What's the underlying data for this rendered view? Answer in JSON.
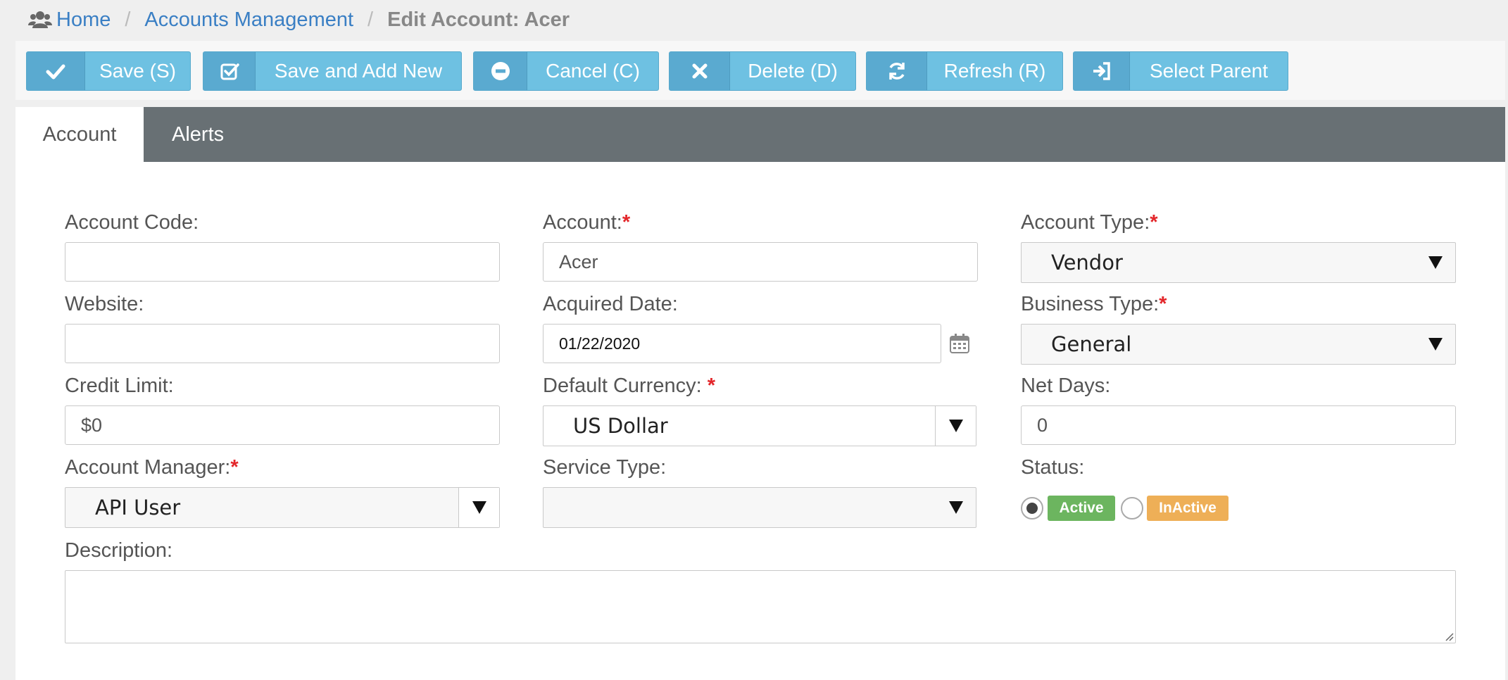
{
  "breadcrumb": {
    "home": "Home",
    "accounts": "Accounts Management",
    "current": "Edit Account: Acer"
  },
  "toolbar": {
    "save": "Save (S)",
    "save_add_new": "Save and Add New",
    "cancel": "Cancel (C)",
    "delete": "Delete (D)",
    "refresh": "Refresh (R)",
    "select_parent": "Select Parent"
  },
  "tabs": {
    "account": "Account",
    "alerts": "Alerts"
  },
  "form": {
    "account_code": {
      "label": "Account Code:",
      "value": ""
    },
    "account": {
      "label": "Account:",
      "value": "Acer"
    },
    "account_type": {
      "label": "Account Type:",
      "value": "Vendor"
    },
    "website": {
      "label": "Website:",
      "value": ""
    },
    "acquired_date": {
      "label": "Acquired Date:",
      "value": "01/22/2020"
    },
    "business_type": {
      "label": "Business Type:",
      "value": "General"
    },
    "credit_limit": {
      "label": "Credit Limit:",
      "value": "$0"
    },
    "default_currency": {
      "label": "Default Currency: ",
      "value": "US Dollar"
    },
    "net_days": {
      "label": "Net Days:",
      "value": "0"
    },
    "account_manager": {
      "label": "Account Manager:",
      "value": "API User"
    },
    "service_type": {
      "label": "Service Type:",
      "value": ""
    },
    "status": {
      "label": "Status:",
      "active": "Active",
      "inactive": "InActive"
    },
    "description": {
      "label": "Description:",
      "value": ""
    },
    "required_mark": "*"
  },
  "colors": {
    "accent": "#6ec1e2",
    "tab_bar": "#687074",
    "required": "#e3262a",
    "active_badge": "#6cb55f",
    "inactive_badge": "#eeaf57"
  },
  "icons": {
    "home": "users-icon",
    "save": "check-icon",
    "save_add_new": "checkbox-icon",
    "cancel": "minus-circle-icon",
    "delete": "x-icon",
    "refresh": "refresh-icon",
    "select_parent": "sign-in-icon",
    "date": "calendar-icon"
  }
}
